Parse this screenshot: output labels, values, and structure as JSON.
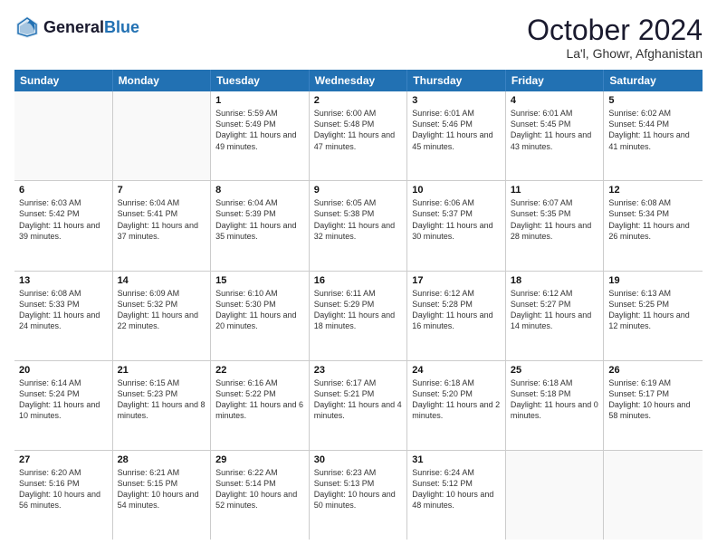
{
  "header": {
    "logo_line1": "General",
    "logo_line2": "Blue",
    "title": "October 2024",
    "subtitle": "La'l, Ghowr, Afghanistan"
  },
  "days_of_week": [
    "Sunday",
    "Monday",
    "Tuesday",
    "Wednesday",
    "Thursday",
    "Friday",
    "Saturday"
  ],
  "weeks": [
    [
      {
        "day": "",
        "text": ""
      },
      {
        "day": "",
        "text": ""
      },
      {
        "day": "1",
        "text": "Sunrise: 5:59 AM\nSunset: 5:49 PM\nDaylight: 11 hours and 49 minutes."
      },
      {
        "day": "2",
        "text": "Sunrise: 6:00 AM\nSunset: 5:48 PM\nDaylight: 11 hours and 47 minutes."
      },
      {
        "day": "3",
        "text": "Sunrise: 6:01 AM\nSunset: 5:46 PM\nDaylight: 11 hours and 45 minutes."
      },
      {
        "day": "4",
        "text": "Sunrise: 6:01 AM\nSunset: 5:45 PM\nDaylight: 11 hours and 43 minutes."
      },
      {
        "day": "5",
        "text": "Sunrise: 6:02 AM\nSunset: 5:44 PM\nDaylight: 11 hours and 41 minutes."
      }
    ],
    [
      {
        "day": "6",
        "text": "Sunrise: 6:03 AM\nSunset: 5:42 PM\nDaylight: 11 hours and 39 minutes."
      },
      {
        "day": "7",
        "text": "Sunrise: 6:04 AM\nSunset: 5:41 PM\nDaylight: 11 hours and 37 minutes."
      },
      {
        "day": "8",
        "text": "Sunrise: 6:04 AM\nSunset: 5:39 PM\nDaylight: 11 hours and 35 minutes."
      },
      {
        "day": "9",
        "text": "Sunrise: 6:05 AM\nSunset: 5:38 PM\nDaylight: 11 hours and 32 minutes."
      },
      {
        "day": "10",
        "text": "Sunrise: 6:06 AM\nSunset: 5:37 PM\nDaylight: 11 hours and 30 minutes."
      },
      {
        "day": "11",
        "text": "Sunrise: 6:07 AM\nSunset: 5:35 PM\nDaylight: 11 hours and 28 minutes."
      },
      {
        "day": "12",
        "text": "Sunrise: 6:08 AM\nSunset: 5:34 PM\nDaylight: 11 hours and 26 minutes."
      }
    ],
    [
      {
        "day": "13",
        "text": "Sunrise: 6:08 AM\nSunset: 5:33 PM\nDaylight: 11 hours and 24 minutes."
      },
      {
        "day": "14",
        "text": "Sunrise: 6:09 AM\nSunset: 5:32 PM\nDaylight: 11 hours and 22 minutes."
      },
      {
        "day": "15",
        "text": "Sunrise: 6:10 AM\nSunset: 5:30 PM\nDaylight: 11 hours and 20 minutes."
      },
      {
        "day": "16",
        "text": "Sunrise: 6:11 AM\nSunset: 5:29 PM\nDaylight: 11 hours and 18 minutes."
      },
      {
        "day": "17",
        "text": "Sunrise: 6:12 AM\nSunset: 5:28 PM\nDaylight: 11 hours and 16 minutes."
      },
      {
        "day": "18",
        "text": "Sunrise: 6:12 AM\nSunset: 5:27 PM\nDaylight: 11 hours and 14 minutes."
      },
      {
        "day": "19",
        "text": "Sunrise: 6:13 AM\nSunset: 5:25 PM\nDaylight: 11 hours and 12 minutes."
      }
    ],
    [
      {
        "day": "20",
        "text": "Sunrise: 6:14 AM\nSunset: 5:24 PM\nDaylight: 11 hours and 10 minutes."
      },
      {
        "day": "21",
        "text": "Sunrise: 6:15 AM\nSunset: 5:23 PM\nDaylight: 11 hours and 8 minutes."
      },
      {
        "day": "22",
        "text": "Sunrise: 6:16 AM\nSunset: 5:22 PM\nDaylight: 11 hours and 6 minutes."
      },
      {
        "day": "23",
        "text": "Sunrise: 6:17 AM\nSunset: 5:21 PM\nDaylight: 11 hours and 4 minutes."
      },
      {
        "day": "24",
        "text": "Sunrise: 6:18 AM\nSunset: 5:20 PM\nDaylight: 11 hours and 2 minutes."
      },
      {
        "day": "25",
        "text": "Sunrise: 6:18 AM\nSunset: 5:18 PM\nDaylight: 11 hours and 0 minutes."
      },
      {
        "day": "26",
        "text": "Sunrise: 6:19 AM\nSunset: 5:17 PM\nDaylight: 10 hours and 58 minutes."
      }
    ],
    [
      {
        "day": "27",
        "text": "Sunrise: 6:20 AM\nSunset: 5:16 PM\nDaylight: 10 hours and 56 minutes."
      },
      {
        "day": "28",
        "text": "Sunrise: 6:21 AM\nSunset: 5:15 PM\nDaylight: 10 hours and 54 minutes."
      },
      {
        "day": "29",
        "text": "Sunrise: 6:22 AM\nSunset: 5:14 PM\nDaylight: 10 hours and 52 minutes."
      },
      {
        "day": "30",
        "text": "Sunrise: 6:23 AM\nSunset: 5:13 PM\nDaylight: 10 hours and 50 minutes."
      },
      {
        "day": "31",
        "text": "Sunrise: 6:24 AM\nSunset: 5:12 PM\nDaylight: 10 hours and 48 minutes."
      },
      {
        "day": "",
        "text": ""
      },
      {
        "day": "",
        "text": ""
      }
    ]
  ]
}
